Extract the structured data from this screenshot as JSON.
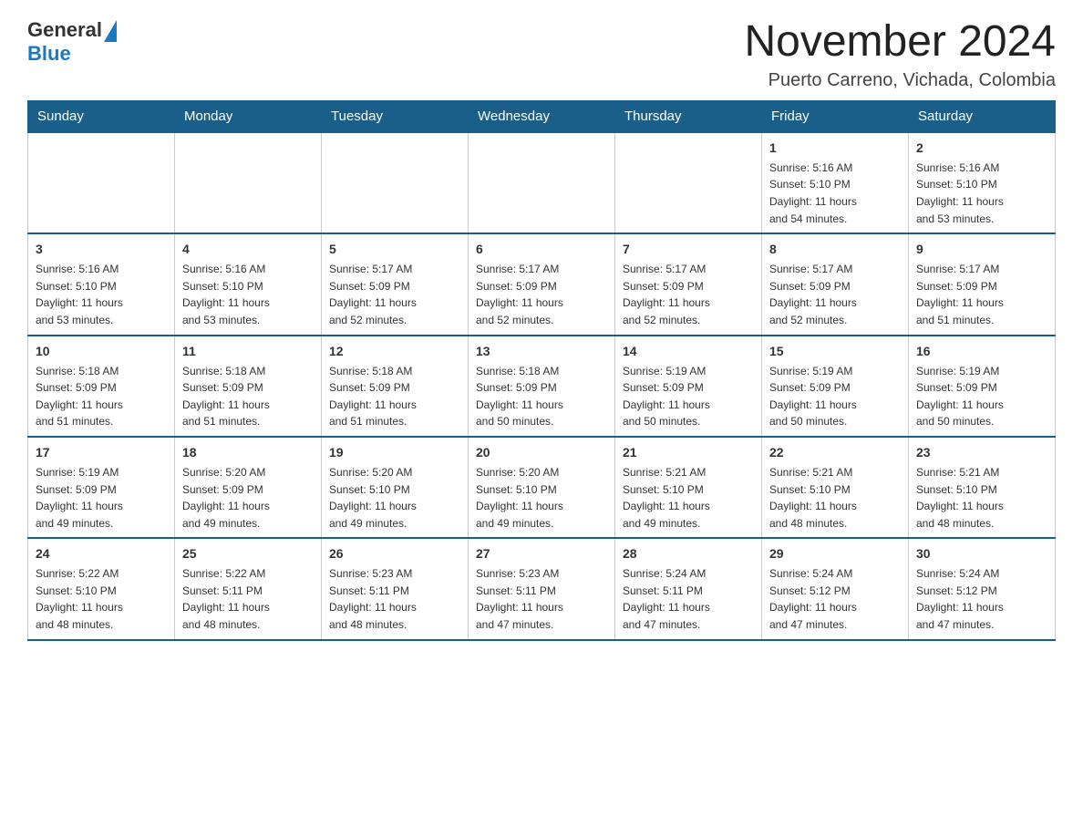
{
  "logo": {
    "general": "General",
    "blue": "Blue"
  },
  "header": {
    "title": "November 2024",
    "subtitle": "Puerto Carreno, Vichada, Colombia"
  },
  "columns": [
    "Sunday",
    "Monday",
    "Tuesday",
    "Wednesday",
    "Thursday",
    "Friday",
    "Saturday"
  ],
  "weeks": [
    [
      {
        "day": "",
        "info": ""
      },
      {
        "day": "",
        "info": ""
      },
      {
        "day": "",
        "info": ""
      },
      {
        "day": "",
        "info": ""
      },
      {
        "day": "",
        "info": ""
      },
      {
        "day": "1",
        "info": "Sunrise: 5:16 AM\nSunset: 5:10 PM\nDaylight: 11 hours\nand 54 minutes."
      },
      {
        "day": "2",
        "info": "Sunrise: 5:16 AM\nSunset: 5:10 PM\nDaylight: 11 hours\nand 53 minutes."
      }
    ],
    [
      {
        "day": "3",
        "info": "Sunrise: 5:16 AM\nSunset: 5:10 PM\nDaylight: 11 hours\nand 53 minutes."
      },
      {
        "day": "4",
        "info": "Sunrise: 5:16 AM\nSunset: 5:10 PM\nDaylight: 11 hours\nand 53 minutes."
      },
      {
        "day": "5",
        "info": "Sunrise: 5:17 AM\nSunset: 5:09 PM\nDaylight: 11 hours\nand 52 minutes."
      },
      {
        "day": "6",
        "info": "Sunrise: 5:17 AM\nSunset: 5:09 PM\nDaylight: 11 hours\nand 52 minutes."
      },
      {
        "day": "7",
        "info": "Sunrise: 5:17 AM\nSunset: 5:09 PM\nDaylight: 11 hours\nand 52 minutes."
      },
      {
        "day": "8",
        "info": "Sunrise: 5:17 AM\nSunset: 5:09 PM\nDaylight: 11 hours\nand 52 minutes."
      },
      {
        "day": "9",
        "info": "Sunrise: 5:17 AM\nSunset: 5:09 PM\nDaylight: 11 hours\nand 51 minutes."
      }
    ],
    [
      {
        "day": "10",
        "info": "Sunrise: 5:18 AM\nSunset: 5:09 PM\nDaylight: 11 hours\nand 51 minutes."
      },
      {
        "day": "11",
        "info": "Sunrise: 5:18 AM\nSunset: 5:09 PM\nDaylight: 11 hours\nand 51 minutes."
      },
      {
        "day": "12",
        "info": "Sunrise: 5:18 AM\nSunset: 5:09 PM\nDaylight: 11 hours\nand 51 minutes."
      },
      {
        "day": "13",
        "info": "Sunrise: 5:18 AM\nSunset: 5:09 PM\nDaylight: 11 hours\nand 50 minutes."
      },
      {
        "day": "14",
        "info": "Sunrise: 5:19 AM\nSunset: 5:09 PM\nDaylight: 11 hours\nand 50 minutes."
      },
      {
        "day": "15",
        "info": "Sunrise: 5:19 AM\nSunset: 5:09 PM\nDaylight: 11 hours\nand 50 minutes."
      },
      {
        "day": "16",
        "info": "Sunrise: 5:19 AM\nSunset: 5:09 PM\nDaylight: 11 hours\nand 50 minutes."
      }
    ],
    [
      {
        "day": "17",
        "info": "Sunrise: 5:19 AM\nSunset: 5:09 PM\nDaylight: 11 hours\nand 49 minutes."
      },
      {
        "day": "18",
        "info": "Sunrise: 5:20 AM\nSunset: 5:09 PM\nDaylight: 11 hours\nand 49 minutes."
      },
      {
        "day": "19",
        "info": "Sunrise: 5:20 AM\nSunset: 5:10 PM\nDaylight: 11 hours\nand 49 minutes."
      },
      {
        "day": "20",
        "info": "Sunrise: 5:20 AM\nSunset: 5:10 PM\nDaylight: 11 hours\nand 49 minutes."
      },
      {
        "day": "21",
        "info": "Sunrise: 5:21 AM\nSunset: 5:10 PM\nDaylight: 11 hours\nand 49 minutes."
      },
      {
        "day": "22",
        "info": "Sunrise: 5:21 AM\nSunset: 5:10 PM\nDaylight: 11 hours\nand 48 minutes."
      },
      {
        "day": "23",
        "info": "Sunrise: 5:21 AM\nSunset: 5:10 PM\nDaylight: 11 hours\nand 48 minutes."
      }
    ],
    [
      {
        "day": "24",
        "info": "Sunrise: 5:22 AM\nSunset: 5:10 PM\nDaylight: 11 hours\nand 48 minutes."
      },
      {
        "day": "25",
        "info": "Sunrise: 5:22 AM\nSunset: 5:11 PM\nDaylight: 11 hours\nand 48 minutes."
      },
      {
        "day": "26",
        "info": "Sunrise: 5:23 AM\nSunset: 5:11 PM\nDaylight: 11 hours\nand 48 minutes."
      },
      {
        "day": "27",
        "info": "Sunrise: 5:23 AM\nSunset: 5:11 PM\nDaylight: 11 hours\nand 47 minutes."
      },
      {
        "day": "28",
        "info": "Sunrise: 5:24 AM\nSunset: 5:11 PM\nDaylight: 11 hours\nand 47 minutes."
      },
      {
        "day": "29",
        "info": "Sunrise: 5:24 AM\nSunset: 5:12 PM\nDaylight: 11 hours\nand 47 minutes."
      },
      {
        "day": "30",
        "info": "Sunrise: 5:24 AM\nSunset: 5:12 PM\nDaylight: 11 hours\nand 47 minutes."
      }
    ]
  ]
}
